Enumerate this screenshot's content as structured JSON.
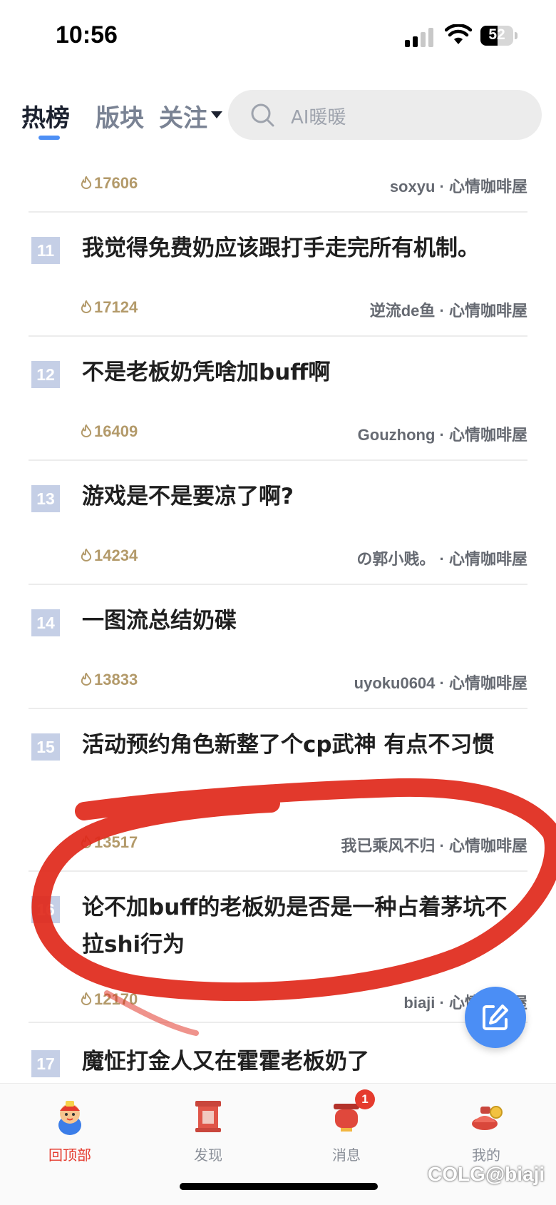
{
  "status": {
    "time": "10:56",
    "battery": "52",
    "battery_level": 0.52
  },
  "nav": {
    "tabs": [
      "热榜",
      "版块",
      "关注"
    ],
    "active_tab": "热榜",
    "search_placeholder": "AI暖暖"
  },
  "first_partial": {
    "heat": "17606",
    "author": "soxyu",
    "board": "心情咖啡屋"
  },
  "items": [
    {
      "rank": "11",
      "title": "我觉得免费奶应该跟打手走完所有机制。",
      "heat": "17124",
      "author": "逆流de鱼",
      "board": "心情咖啡屋"
    },
    {
      "rank": "12",
      "title": "不是老板奶凭啥加buff啊",
      "heat": "16409",
      "author": "Gouzhong",
      "board": "心情咖啡屋"
    },
    {
      "rank": "13",
      "title": "游戏是不是要凉了啊?",
      "heat": "14234",
      "author": "の郭小贱。",
      "board": "心情咖啡屋"
    },
    {
      "rank": "14",
      "title": "一图流总结奶碟",
      "heat": "13833",
      "author": "uyoku0604",
      "board": "心情咖啡屋"
    },
    {
      "rank": "15",
      "title": "活动预约角色新整了个cp武神  有点不习惯",
      "heat": "13517",
      "author": "我已乘风不归",
      "board": "心情咖啡屋"
    },
    {
      "rank": "16",
      "title": "论不加buff的老板奶是否是一种占着茅坑不拉shi行为",
      "heat": "12170",
      "author": "biaji",
      "board": "心情咖啡屋"
    },
    {
      "rank": "17",
      "title": "魔怔打金人又在霍霍老板奶了",
      "heat": "",
      "author": "",
      "board": ""
    }
  ],
  "separator": "·",
  "tabbar": [
    {
      "label": "回顶部",
      "icon": "mascot-icon",
      "active": true
    },
    {
      "label": "发现",
      "icon": "discover-icon",
      "active": false
    },
    {
      "label": "消息",
      "icon": "message-icon",
      "active": false,
      "badge": "1"
    },
    {
      "label": "我的",
      "icon": "profile-icon",
      "active": false
    }
  ],
  "watermark": "COLG@biaji",
  "colors": {
    "accent": "#4b8ef5",
    "heat": "#b39a6a",
    "rank_bg": "#c5cfe6",
    "annotation": "#e0281a",
    "active_tab": "#e53b2e"
  }
}
